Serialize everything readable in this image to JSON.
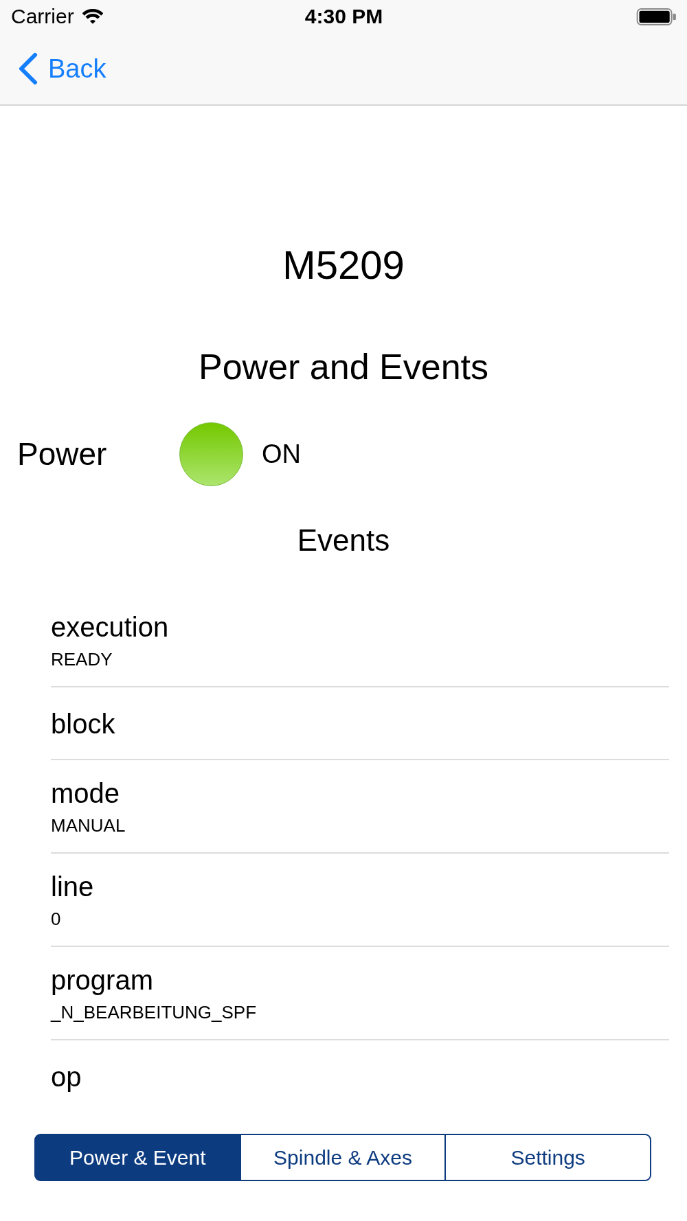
{
  "status_bar": {
    "carrier": "Carrier",
    "time": "4:30 PM"
  },
  "nav_bar": {
    "back": "Back"
  },
  "title": "M5209",
  "section_title": "Power and Events",
  "power": {
    "label": "Power",
    "on": true,
    "status": "ON"
  },
  "events": {
    "title": "Events",
    "rows": [
      {
        "name": "execution",
        "value": "READY"
      },
      {
        "name": "block"
      },
      {
        "name": "mode",
        "value": "MANUAL"
      },
      {
        "name": "line",
        "value": "0"
      },
      {
        "name": "program",
        "value": "_N_BEARBEITUNG_SPF"
      },
      {
        "name": "op"
      }
    ]
  },
  "segments": [
    {
      "label": "Power & Event",
      "selected": true
    },
    {
      "label": "Spindle & Axes",
      "selected": false
    },
    {
      "label": "Settings",
      "selected": false
    }
  ]
}
